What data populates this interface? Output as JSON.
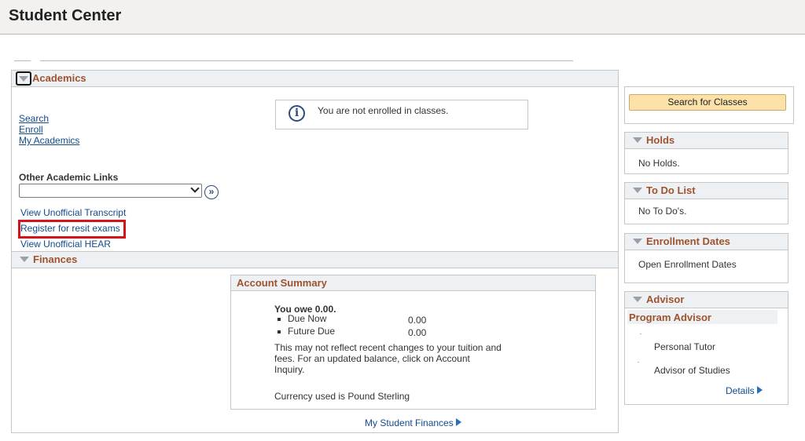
{
  "page": {
    "title": "Student Center"
  },
  "academics": {
    "title": "Academics",
    "links": [
      "Search",
      "Enroll",
      "My Academics"
    ],
    "info_message": "You are not enrolled in classes.",
    "other_links_label": "Other Academic Links",
    "other_links_selected": "",
    "extra_links": [
      "View Unofficial Transcript",
      "Register for resit exams",
      "View Unofficial HEAR"
    ]
  },
  "finances": {
    "title": "Finances",
    "account_summary": {
      "title": "Account Summary",
      "you_owe": "You owe 0.00.",
      "rows": [
        {
          "label": "Due Now",
          "value": "0.00"
        },
        {
          "label": "Future Due",
          "value": "0.00"
        }
      ],
      "note": "This may not reflect recent changes to your tuition and fees.  For an updated balance, click on Account Inquiry.",
      "currency": "Currency used is Pound Sterling"
    },
    "link": "My Student Finances"
  },
  "sidebar": {
    "search_button": "Search for Classes",
    "holds": {
      "title": "Holds",
      "body": "No Holds."
    },
    "todo": {
      "title": "To Do List",
      "body": "No To Do's."
    },
    "enrollment": {
      "title": "Enrollment Dates",
      "link": "Open Enrollment Dates"
    },
    "advisor": {
      "title": "Advisor",
      "subtitle": "Program Advisor",
      "items": [
        "Personal Tutor",
        "Advisor of Studies"
      ],
      "details": "Details"
    }
  },
  "colors": {
    "accent": "#a0522d",
    "link": "#124b8c",
    "highlight": "#d3141a",
    "button": "#fce2a8"
  }
}
